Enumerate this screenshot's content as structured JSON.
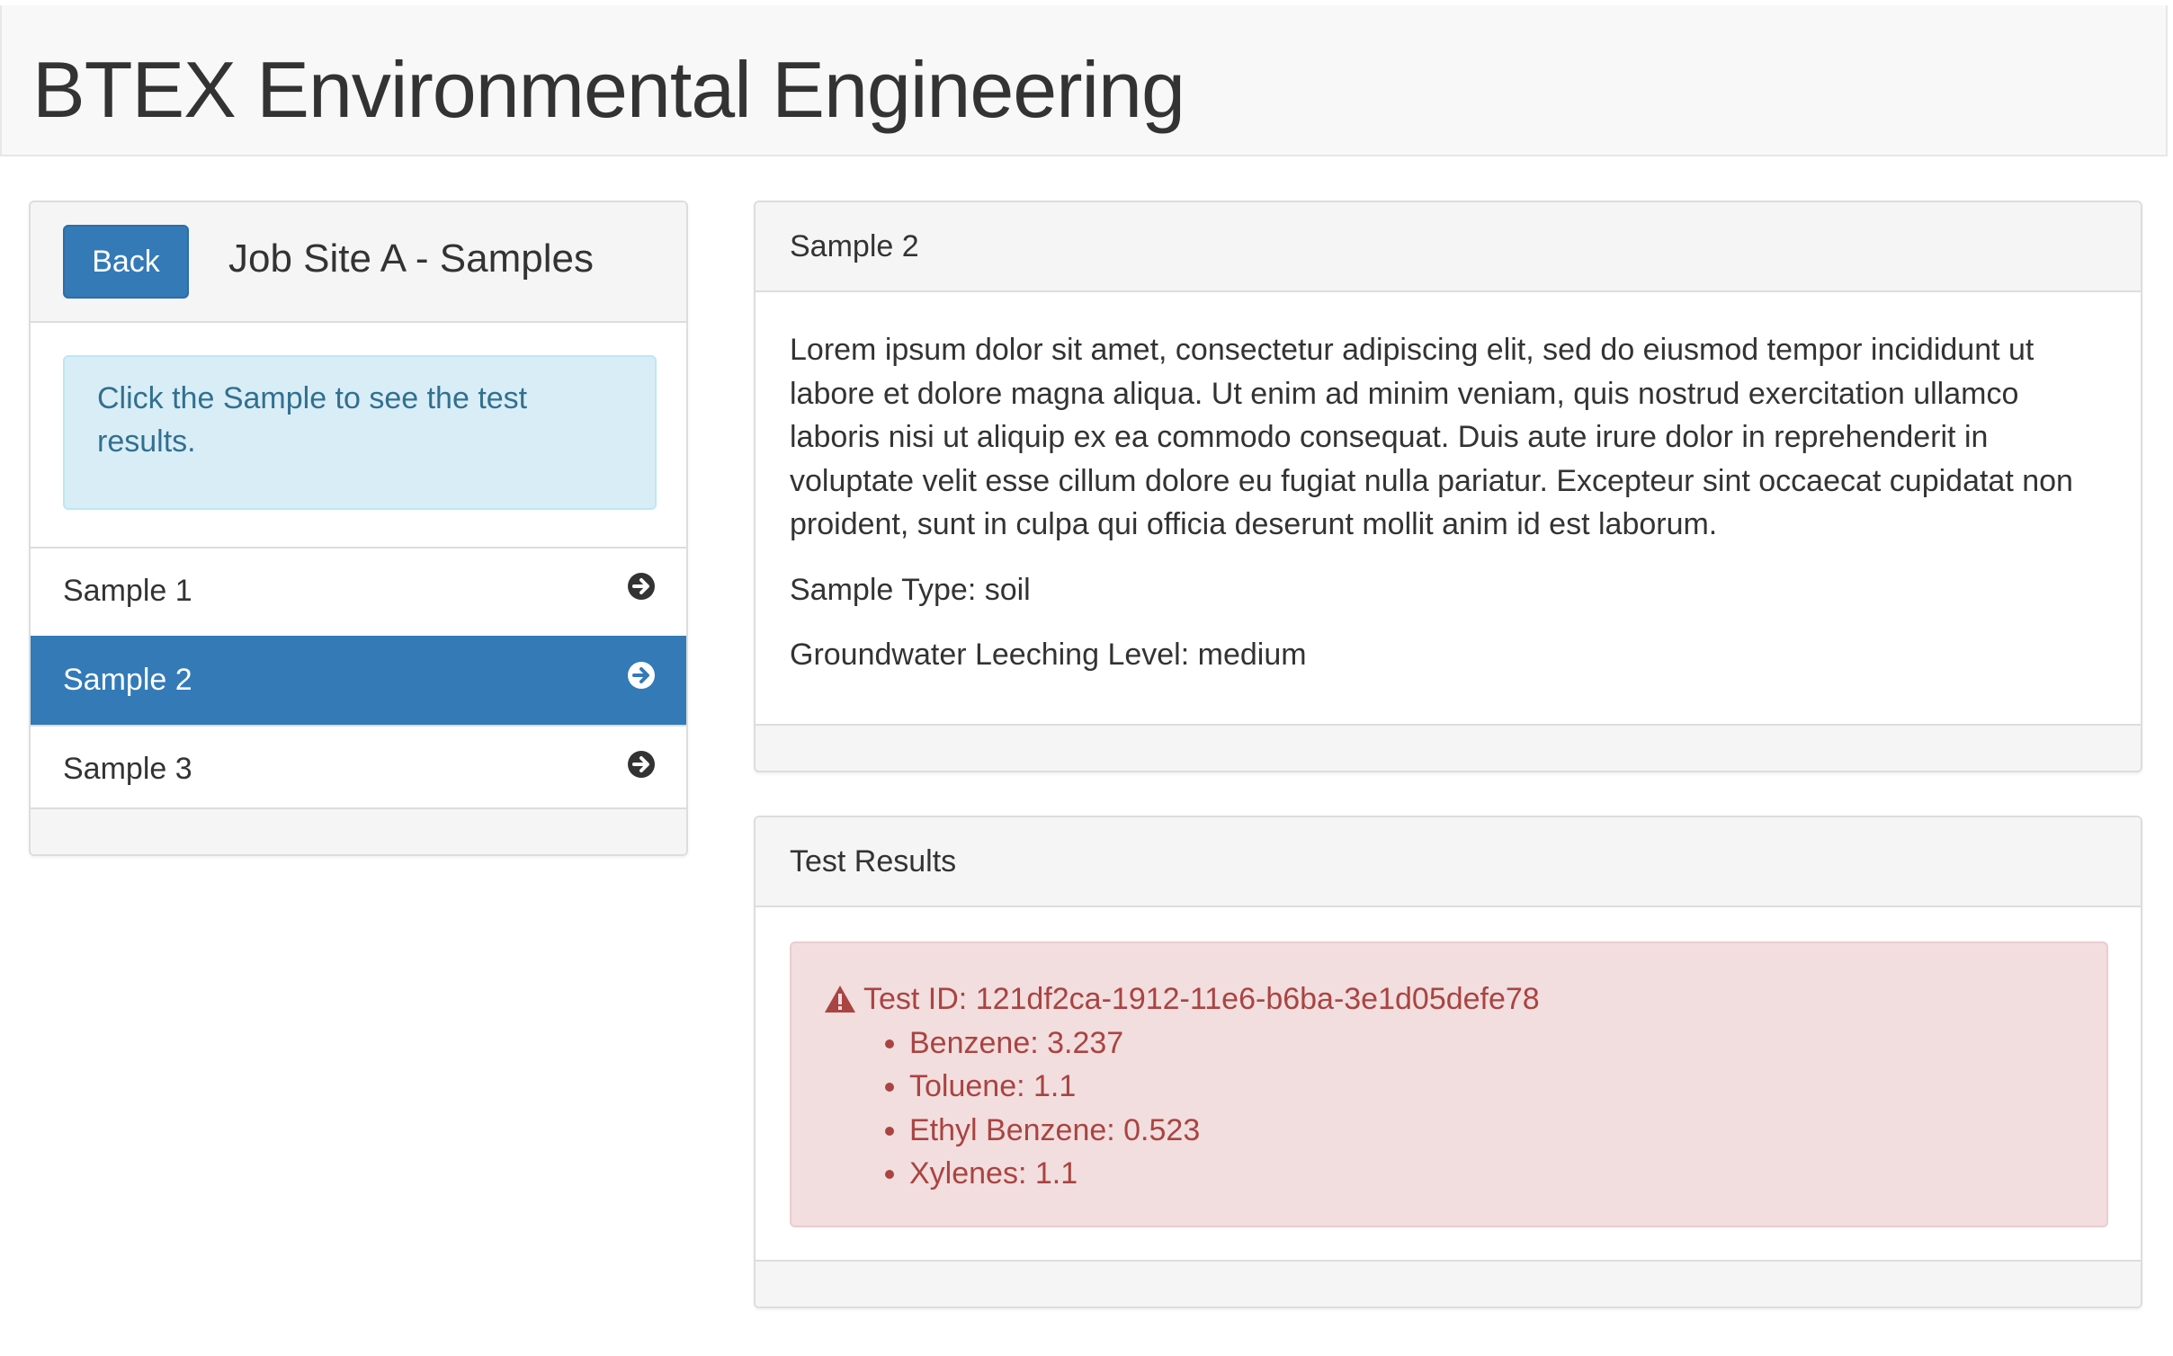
{
  "app": {
    "title": "BTEX Environmental Engineering"
  },
  "sidebar": {
    "back_label": "Back",
    "title": "Job Site A - Samples",
    "info": "Click the Sample to see the test results.",
    "items": [
      {
        "label": "Sample 1",
        "active": false
      },
      {
        "label": "Sample 2",
        "active": true
      },
      {
        "label": "Sample 3",
        "active": false
      }
    ]
  },
  "sample": {
    "title": "Sample 2",
    "description": "Lorem ipsum dolor sit amet, consectetur adipiscing elit, sed do eiusmod tempor incididunt ut labore et dolore magna aliqua. Ut enim ad minim veniam, quis nostrud exercitation ullamco laboris nisi ut aliquip ex ea commodo consequat. Duis aute irure dolor in reprehenderit in voluptate velit esse cillum dolore eu fugiat nulla pariatur. Excepteur sint occaecat cupidatat non proident, sunt in culpa qui officia deserunt mollit anim id est laborum.",
    "type_line": "Sample Type: soil",
    "leeching_line": "Groundwater Leeching Level: medium"
  },
  "results": {
    "title": "Test Results",
    "test_id": "Test ID: 121df2ca-1912-11e6-b6ba-3e1d05defe78",
    "items": [
      "Benzene: 3.237",
      "Toluene: 1.1",
      "Ethyl Benzene: 0.523",
      "Xylenes: 1.1"
    ]
  },
  "colors": {
    "primary": "#337ab7",
    "info_bg": "#d9edf7",
    "info_text": "#31708f",
    "danger_bg": "#f2dede",
    "danger_text": "#a94442"
  },
  "icons": {
    "list_arrow": "circle-arrow-right-icon",
    "warning": "warning-triangle-icon"
  }
}
